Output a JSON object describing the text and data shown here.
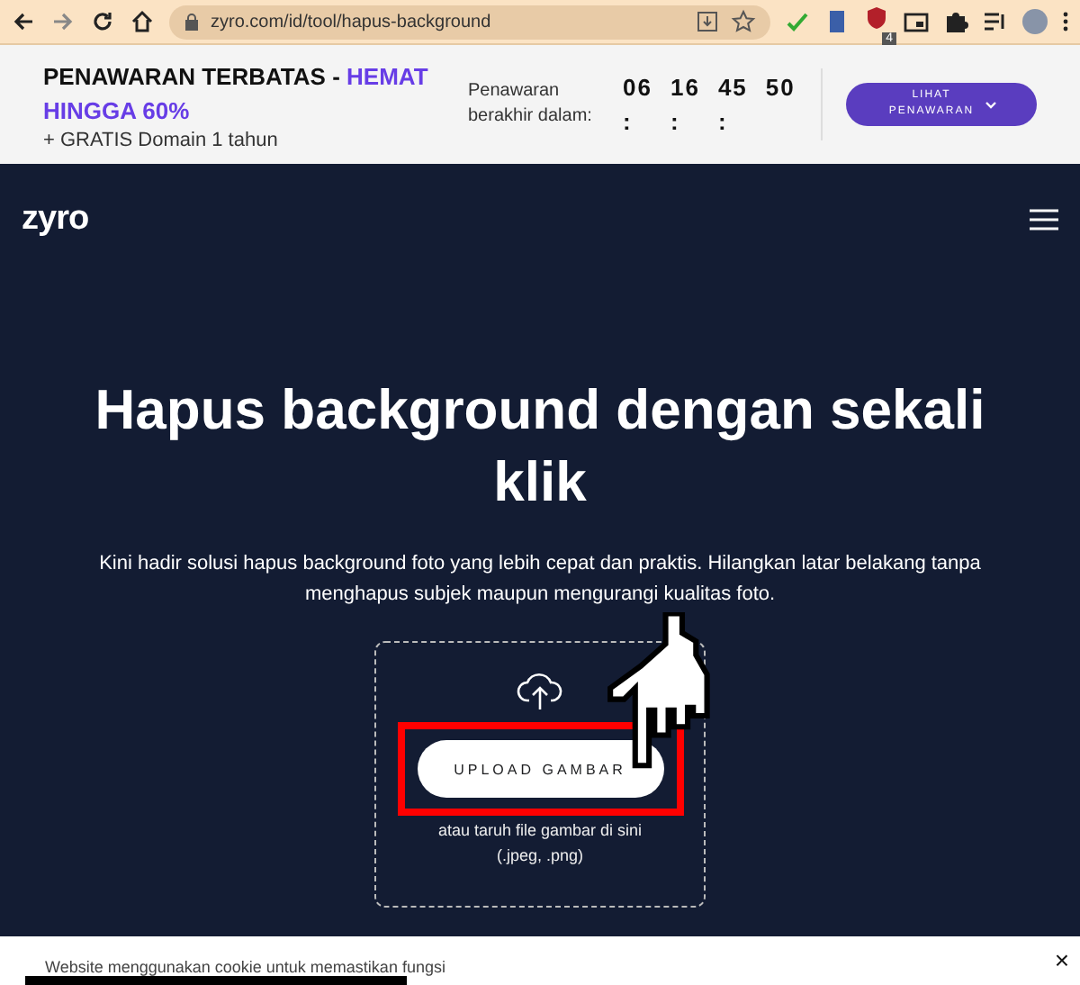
{
  "browser": {
    "url": "zyro.com/id/tool/hapus-background",
    "extension_badge": "4"
  },
  "promo": {
    "title": "PENAWARAN TERBATAS - ",
    "highlight": "HEMAT HINGGA 60%",
    "subtitle": "+ GRATIS Domain 1 tahun",
    "countdown_label": "Penawaran berakhir dalam:",
    "countdown": [
      "06",
      "16",
      "45",
      "50"
    ],
    "separator": ":",
    "button": "LIHAT PENAWARAN"
  },
  "nav": {
    "logo": "zyro"
  },
  "hero": {
    "title": "Hapus background dengan sekali klik",
    "description": "Kini hadir solusi hapus background foto yang lebih cepat dan praktis. Hilangkan latar belakang tanpa menghapus subjek maupun mengurangi kualitas foto.",
    "upload_button": "UPLOAD GAMBAR",
    "drop_hint": "atau taruh file gambar di sini",
    "formats": "(.jpeg, .png)"
  },
  "cookie": {
    "text": "Website menggunakan cookie untuk memastikan fungsi",
    "close": "×"
  }
}
